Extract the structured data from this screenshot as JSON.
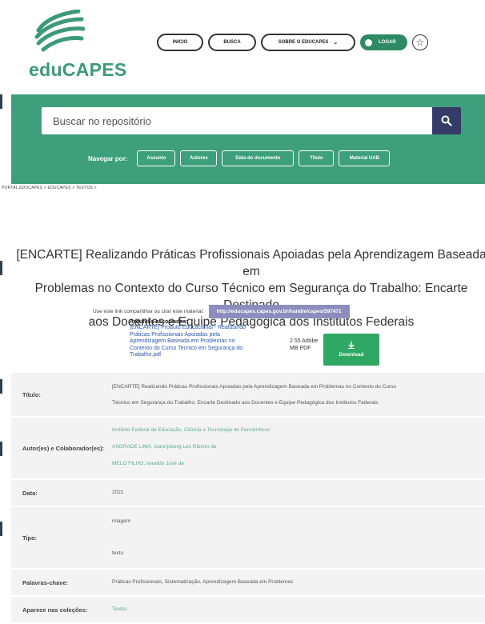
{
  "header": {
    "logo_text": "eduCAPES",
    "nav": [
      {
        "label": "INICIO"
      },
      {
        "label": "BUSCA"
      },
      {
        "label": "SOBRE O EDUCAPES"
      }
    ],
    "login_label": "LOGAR"
  },
  "search": {
    "placeholder": "Buscar no repositório",
    "browse_label": "Navegar por:",
    "browse_buttons": [
      "Assunto",
      "Autores",
      "Data do documento",
      "Título",
      "Material UAB"
    ]
  },
  "breadcrumb": "PORTAL EDUCAPES > EDUCAPES > TEXTOS >",
  "item": {
    "title": "[ENCARTE] Realizando Práticas Profissionais Apoiadas pela Aprendizagem Baseada em\nProblemas no Contexto do Curso Técnico em Segurança do Trabalho: Encarte Destinado\naos Docentes e Equipe Pedagógica dos Institutos Federais",
    "share_label": "Use este link compartilhar ou citar este material:",
    "share_link": "http://educapes.capes.gov.br/handle/capes/597471",
    "files_label": "Arquivos associados:",
    "file_name": "[ENCARTE] Produto Educacional - Realizando\nPráticas Profissionais Apoiadas pela\nAprendizagem Baseada em Problemas no\nContexto do Curso Tecnico em Segurança do\nTrabalho.pdf",
    "file_size": "2.55 Adobe\nMB  PDF",
    "download_label": "Download"
  },
  "metadata": [
    {
      "label": "Título:",
      "values": [
        "[ENCARTE] Realizando Práticas Profissionais Apoiadas pela Aprendizagem Baseada em Problemas no Contexto do Curso",
        "Técnico em Segurança do Trabalho: Encarte Destinado aos Docentes e Equipe Pedagógica dos Institutos Federais"
      ]
    },
    {
      "label": "Autor(es) e Colaborador(es):",
      "values": [
        "Instituto Federal de Educação, Ciência e Tecnologia de Pernambuco",
        "ANDRADE LIMA, Ioannjsberg Leo Ribeiro de",
        "MELO FILHO, Ivanildo José de"
      ]
    },
    {
      "label": "Data:",
      "values": [
        "2021"
      ]
    },
    {
      "label": "Tipo:",
      "values": [
        "imagem",
        "texto"
      ]
    },
    {
      "label": "Palavras-chave:",
      "values": [
        "Práticas Profissionais, Sistematização, Aprendizagem Baseada em Problemas"
      ]
    },
    {
      "label": "Aparece nas coleções:",
      "values": [
        "Textos"
      ]
    }
  ]
}
